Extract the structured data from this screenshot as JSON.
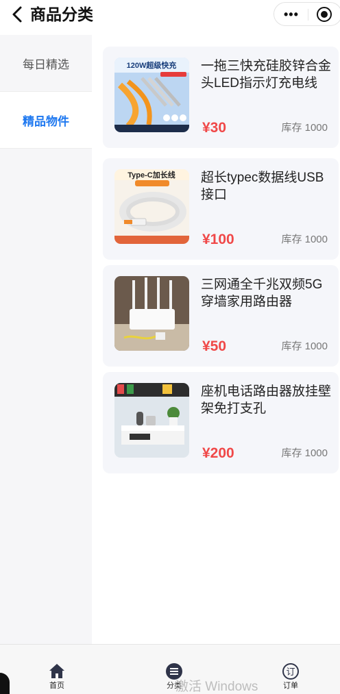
{
  "nav": {
    "title": "商品分类",
    "menu_glyph": "•••"
  },
  "categories": [
    {
      "label": "每日精选",
      "active": false
    },
    {
      "label": "精品物件",
      "active": true
    }
  ],
  "products": [
    {
      "title": "一拖三快充硅胶锌合金头LED指示灯充电线",
      "price": "¥30",
      "stock": "库存 1000",
      "image_text": "120W超级快充"
    },
    {
      "title": "超长typec数据线USB接口",
      "price": "¥100",
      "stock": "库存 1000",
      "image_text": "Type-C加长线"
    },
    {
      "title": "三网通全千兆双频5G穿墙家用路由器",
      "price": "¥50",
      "stock": "库存 1000"
    },
    {
      "title": "座机电话路由器放挂壁架免打支孔",
      "price": "¥200",
      "stock": "库存 1000"
    }
  ],
  "tabbar": [
    {
      "label": "首页",
      "icon": "home-icon"
    },
    {
      "label": "分类",
      "icon": "list-icon",
      "active": true
    },
    {
      "label": "订单",
      "icon": "order-icon",
      "icon_text": "订"
    }
  ],
  "watermark": "激活 Windows",
  "colors": {
    "accent": "#1e78f0",
    "price": "#f04848",
    "card_bg": "#f5f6fa",
    "sidebar_bg": "#f6f6f8"
  }
}
